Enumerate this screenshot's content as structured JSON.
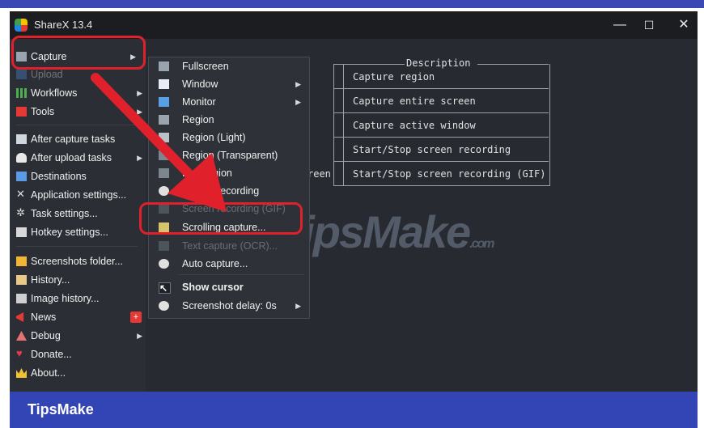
{
  "window": {
    "title": "ShareX 13.4",
    "minimize": "—",
    "maximize": "☐",
    "close": "✕"
  },
  "left_menu": {
    "items": [
      {
        "label": "Capture",
        "icon": "capture-icon",
        "has_submenu": true
      },
      {
        "label": "Upload",
        "icon": "upload-icon",
        "has_submenu": true
      },
      {
        "label": "Workflows",
        "icon": "workflows-icon",
        "has_submenu": true
      },
      {
        "label": "Tools",
        "icon": "tools-icon",
        "has_submenu": true
      },
      {
        "label": "After capture tasks",
        "icon": "after-capture-icon",
        "has_submenu": true
      },
      {
        "label": "After upload tasks",
        "icon": "after-upload-icon",
        "has_submenu": true
      },
      {
        "label": "Destinations",
        "icon": "destinations-icon",
        "has_submenu": true
      },
      {
        "label": "Application settings...",
        "icon": "app-settings-icon",
        "has_submenu": false
      },
      {
        "label": "Task settings...",
        "icon": "task-settings-icon",
        "has_submenu": false
      },
      {
        "label": "Hotkey settings...",
        "icon": "hotkey-settings-icon",
        "has_submenu": false
      },
      {
        "label": "Screenshots folder...",
        "icon": "folder-icon",
        "has_submenu": false
      },
      {
        "label": "History...",
        "icon": "history-icon",
        "has_submenu": false
      },
      {
        "label": "Image history...",
        "icon": "image-history-icon",
        "has_submenu": false
      },
      {
        "label": "News",
        "icon": "news-icon",
        "has_submenu": false,
        "badge": "+"
      },
      {
        "label": "Debug",
        "icon": "debug-icon",
        "has_submenu": true
      },
      {
        "label": "Donate...",
        "icon": "heart-icon",
        "has_submenu": false
      },
      {
        "label": "About...",
        "icon": "crown-icon",
        "has_submenu": false
      }
    ]
  },
  "capture_submenu": {
    "items": [
      {
        "label": "Fullscreen",
        "has_submenu": false
      },
      {
        "label": "Window",
        "has_submenu": true
      },
      {
        "label": "Monitor",
        "has_submenu": true
      },
      {
        "label": "Region",
        "has_submenu": false
      },
      {
        "label": "Region (Light)",
        "has_submenu": false
      },
      {
        "label": "Region (Transparent)",
        "has_submenu": false
      },
      {
        "label": "Last region",
        "has_submenu": false
      },
      {
        "label": "Screen recording",
        "has_submenu": false
      },
      {
        "label": "Screen recording (GIF)",
        "has_submenu": false
      },
      {
        "label": "Scrolling capture...",
        "has_submenu": false
      },
      {
        "label": "Text capture (OCR)...",
        "has_submenu": false
      },
      {
        "label": "Auto capture...",
        "has_submenu": false
      },
      {
        "label": "Show cursor",
        "has_submenu": false
      },
      {
        "label": "Screenshot delay: 0s",
        "has_submenu": true
      }
    ]
  },
  "hotkey_table": {
    "header": "Description",
    "rows": [
      {
        "left": "",
        "description": "Capture region"
      },
      {
        "left": "",
        "description": "Capture entire screen"
      },
      {
        "left": "",
        "description": "Capture active window"
      },
      {
        "left": "",
        "description": "Start/Stop screen recording"
      },
      {
        "left": "reen",
        "description": "Start/Stop screen recording (GIF)"
      }
    ]
  },
  "watermark": {
    "text": "TipsMake",
    "suffix": ".com"
  },
  "banner": {
    "text": "TipsMake"
  },
  "colors": {
    "highlight": "#e0202a",
    "banner": "#3344b4",
    "window_bg": "#272b31"
  }
}
